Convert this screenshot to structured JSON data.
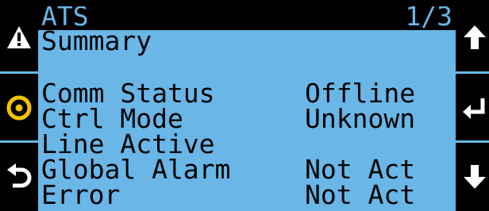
{
  "header": {
    "title": "ATS",
    "page": "1/3"
  },
  "subtitle": "Summary",
  "rows": [
    {
      "label": "Comm Status",
      "value": "Offline"
    },
    {
      "label": "Ctrl Mode",
      "value": "Unknown"
    },
    {
      "label": "Line Active",
      "value": ""
    },
    {
      "label": "Global Alarm",
      "value": "Not Act"
    },
    {
      "label": "Error",
      "value": "Not Act"
    }
  ],
  "buttons": {
    "left": [
      "warning-icon",
      "target-icon",
      "back-icon"
    ],
    "right": [
      "arrow-up-icon",
      "enter-icon",
      "arrow-down-icon"
    ]
  },
  "colors": {
    "screen": "#69b6e7",
    "bezel": "#000000",
    "accent": "#f5c400"
  }
}
